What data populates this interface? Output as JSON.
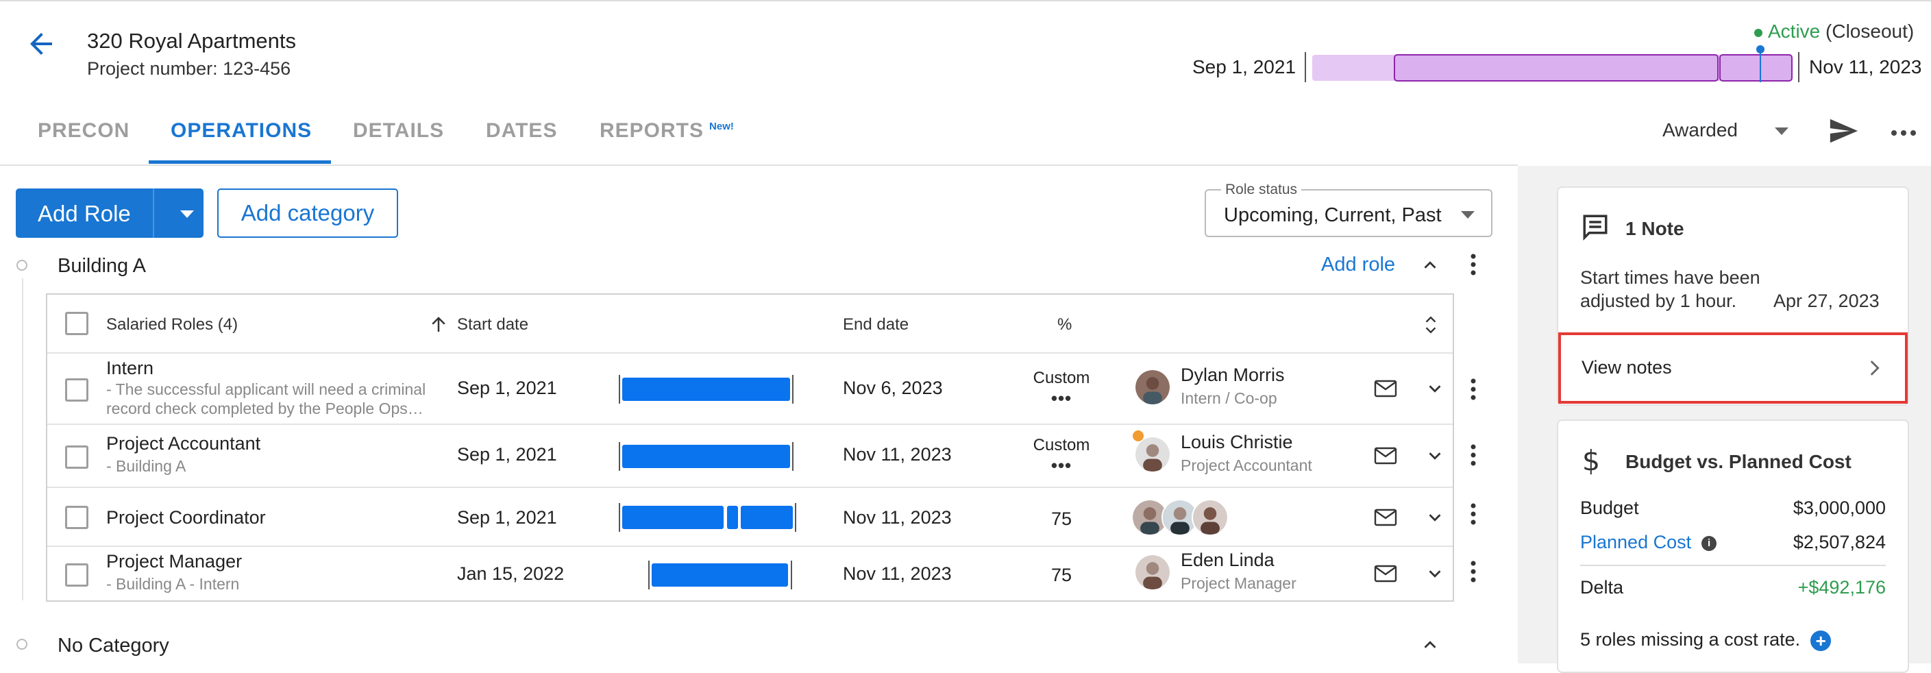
{
  "header": {
    "project_title": "320 Royal Apartments",
    "project_number": "Project number: 123-456",
    "status_active": "Active",
    "status_phase": "(Closeout)",
    "timeline_start": "Sep 1, 2021",
    "timeline_end": "Nov 11, 2023"
  },
  "tabs": [
    {
      "label": "PRECON"
    },
    {
      "label": "OPERATIONS",
      "active": true
    },
    {
      "label": "DETAILS"
    },
    {
      "label": "DATES"
    },
    {
      "label": "REPORTS",
      "badge": "New!"
    }
  ],
  "toolbar": {
    "awarded_label": "Awarded",
    "add_role_label": "Add Role",
    "add_category_label": "Add category",
    "role_status_legend": "Role status",
    "role_status_value": "Upcoming, Current, Past"
  },
  "groups": [
    {
      "title": "Building A",
      "add_role": "Add role"
    },
    {
      "title": "No Category"
    }
  ],
  "table": {
    "headers": {
      "roles": "Salaried Roles (4)",
      "start": "Start date",
      "end": "End date",
      "percent": "%"
    },
    "rows": [
      {
        "role": "Intern",
        "desc": "- The successful applicant will need a criminal",
        "desc2": "record check completed by the People Ops…",
        "start": "Sep 1, 2021",
        "end": "Nov 6, 2023",
        "pct": "Custom",
        "person": "Dylan Morris",
        "person_role": "Intern / Co-op"
      },
      {
        "role": "Project Accountant",
        "desc": "- Building A",
        "start": "Sep 1, 2021",
        "end": "Nov 11, 2023",
        "pct": "Custom",
        "person": "Louis Christie",
        "person_role": "Project Accountant"
      },
      {
        "role": "Project Coordinator",
        "start": "Sep 1, 2021",
        "end": "Nov 11, 2023",
        "pct": "75"
      },
      {
        "role": "Project Manager",
        "desc": "- Building A - Intern",
        "start": "Jan 15, 2022",
        "end": "Nov 11, 2023",
        "pct": "75",
        "person": "Eden Linda",
        "person_role": "Project Manager"
      }
    ]
  },
  "notes": {
    "title": "1 Note",
    "text_line1": "Start times have been",
    "text_line2": "adjusted by 1 hour.",
    "date": "Apr 27, 2023",
    "view_label": "View notes"
  },
  "budget": {
    "title": "Budget vs. Planned Cost",
    "budget_label": "Budget",
    "budget_value": "$3,000,000",
    "planned_label": "Planned Cost",
    "planned_value": "$2,507,824",
    "delta_label": "Delta",
    "delta_value": "+$492,176",
    "missing": "5 roles missing a cost rate."
  },
  "colors": {
    "accent": "#1976d2",
    "gantt_bar": "#0a73ee",
    "active_green": "#2e9d4f",
    "timeline_purple": "#e6c8f5",
    "highlight_red": "#e53935"
  }
}
